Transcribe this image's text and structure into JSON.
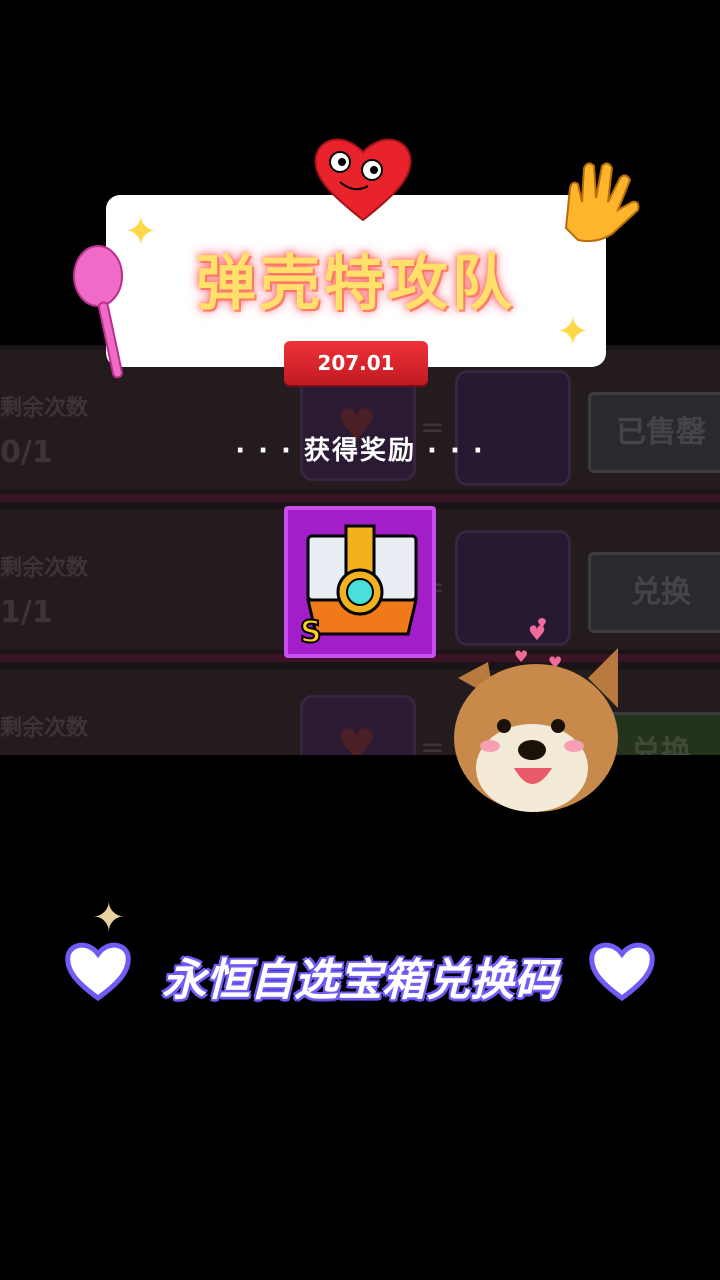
{
  "background_screen": {
    "rows": [
      {
        "label": "剩余次数",
        "count": "0/1",
        "action": "已售罄"
      },
      {
        "label": "剩余次数",
        "count": "1/1",
        "action": "兑换"
      },
      {
        "label": "剩余次数",
        "count": "",
        "action": "兑换"
      }
    ],
    "equals_sign": "=",
    "heart_glyph": "♥"
  },
  "title_card": {
    "game_title": "弹壳特攻队",
    "version": "207.01"
  },
  "reward": {
    "header": "· · ·  获得奖励  · · ·",
    "item_icon": "s-grade-chest-icon",
    "grade_letter": "S"
  },
  "caption": {
    "text": "永恒自选宝箱兑换码"
  },
  "colors": {
    "badge_red": "#e02a32",
    "item_purple": "#a21ec9",
    "caption_outline": "#6f5bf5",
    "title_glow": "#ff5a7a"
  }
}
